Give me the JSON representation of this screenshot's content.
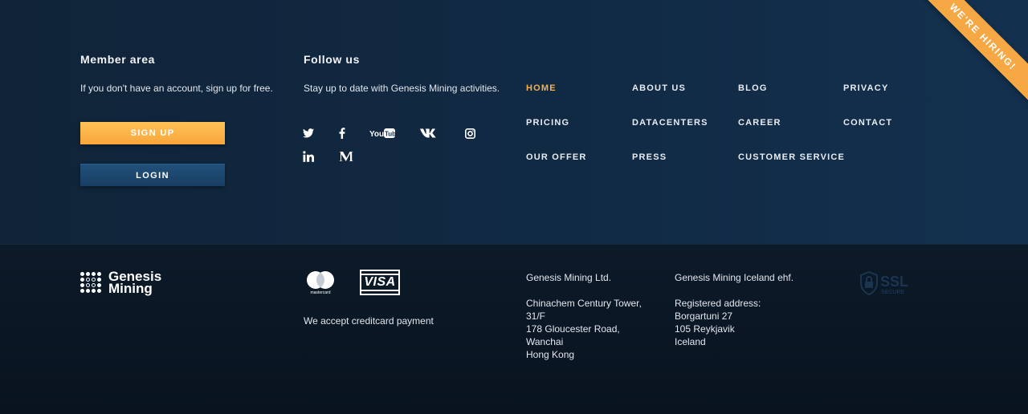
{
  "member": {
    "heading": "Member area",
    "desc": "If you don't have an account, sign up for free.",
    "signup_label": "SIGN UP",
    "login_label": "LOGIN"
  },
  "follow": {
    "heading": "Follow us",
    "desc": "Stay up to date with Genesis Mining activities.",
    "icons": [
      "twitter-icon",
      "facebook-icon",
      "youtube-icon",
      "vk-icon",
      "instagram-icon",
      "linkedin-icon",
      "medium-icon"
    ],
    "youtube_text": "YouTube"
  },
  "nav": {
    "home": "HOME",
    "about": "ABOUT US",
    "blog": "BLOG",
    "privacy": "PRIVACY",
    "pricing": "PRICING",
    "datacenters": "DATACENTERS",
    "career": "CAREER",
    "contact": "CONTACT",
    "offer": "OUR OFFER",
    "press": "PRESS",
    "customer_service": "CUSTOMER SERVICE"
  },
  "hiring": "WE'RE HIRING!",
  "logo": {
    "line1": "Genesis",
    "line2": "Mining"
  },
  "payment": {
    "mastercard_label": "mastercard",
    "visa_label": "VISA",
    "accept_text": "We accept creditcard payment"
  },
  "address_ltd": {
    "name": "Genesis Mining Ltd.",
    "line1": "Chinachem Century Tower,",
    "line2": "31/F",
    "line3": "178 Gloucester Road,",
    "line4": "Wanchai",
    "line5": "Hong Kong"
  },
  "address_iceland": {
    "name": "Genesis Mining Iceland ehf.",
    "line1": "Registered address:",
    "line2": "Borgartuni 27",
    "line3": "105 Reykjavik",
    "line4": "Iceland"
  },
  "ssl": {
    "label": "SSL",
    "sub": "SECURE"
  },
  "colors": {
    "accent": "#f8b04a",
    "top_bg": "#12304e",
    "bottom_bg": "#08131e",
    "login_bg": "#1c4669"
  }
}
